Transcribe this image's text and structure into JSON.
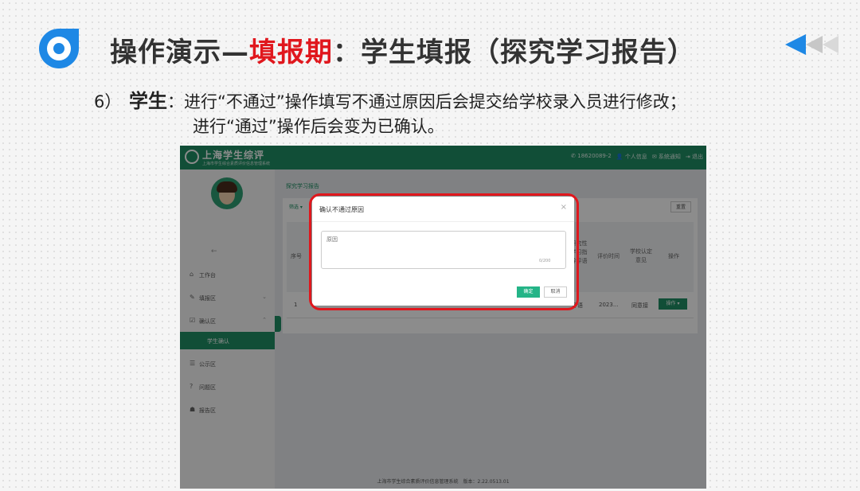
{
  "slide": {
    "title_prefix": "操作演示—",
    "title_highlight": "填报期",
    "title_suffix": "：学生填报（探究学习报告）",
    "step_number": "6）",
    "actor": "学生",
    "actor_colon": "：",
    "line1": "进行“不通过”操作填写不通过原因后会提交给学校录入员进行修改；",
    "line2": "进行“通过”操作后会变为已确认。"
  },
  "colors": {
    "accent_red": "#e0171d",
    "app_green": "#1f8f64",
    "confirm_green": "#24b487",
    "logo_blue": "#1e88e5"
  },
  "app": {
    "name": "上海学生综评",
    "subtitle": "上海市学生综合素质评价信息管理系统",
    "header_right": {
      "phone": "18620089-2",
      "profile": "个人信息",
      "notice": "系统通知",
      "logout": "退出"
    },
    "sidebar": {
      "back_icon": "arrow-left-icon",
      "items": [
        {
          "label": "工作台",
          "icon": "home-icon"
        },
        {
          "label": "填报区",
          "icon": "edit-icon"
        },
        {
          "label": "确认区",
          "icon": "check-square-icon"
        },
        {
          "label": "学生确认",
          "icon": ""
        },
        {
          "label": "公示区",
          "icon": "list-icon"
        },
        {
          "label": "问题区",
          "icon": "question-icon"
        },
        {
          "label": "报告区",
          "icon": "users-icon"
        }
      ]
    },
    "breadcrumb": "探究学习报告",
    "filter_label": "筛选",
    "reset_label": "重置",
    "table": {
      "headers": [
        "序号",
        "研究性学习指导评语",
        "评价时间",
        "学校认定意见",
        "操作"
      ],
      "row": {
        "index": "1",
        "comment": "评语",
        "time": "2023...",
        "opinion": "同意接",
        "op_label": "操作 ▾"
      }
    },
    "footer": "上海市学生综合素质评价信息管理系统　版本：2.22.0513.01"
  },
  "dialog": {
    "title": "确认不通过原因",
    "close": "×",
    "field_placeholder": "原因",
    "counter": "0/200",
    "confirm_label": "确定",
    "cancel_label": "取消"
  }
}
